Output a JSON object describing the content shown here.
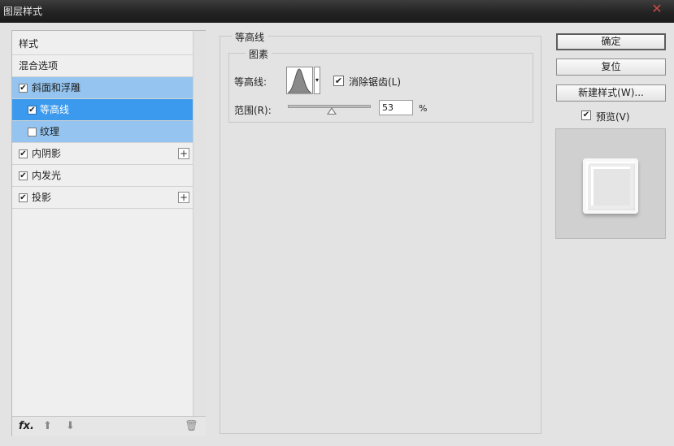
{
  "window": {
    "title": "图层样式",
    "close_glyph": "✕"
  },
  "styles_list": {
    "items": [
      {
        "label": "样式",
        "checkbox": false,
        "checked": false,
        "selected": "none",
        "plus": false,
        "indent": 0
      },
      {
        "label": "混合选项",
        "checkbox": false,
        "checked": false,
        "selected": "none",
        "plus": false,
        "indent": 0
      },
      {
        "label": "斜面和浮雕",
        "checkbox": true,
        "checked": true,
        "selected": "light",
        "plus": false,
        "indent": 0
      },
      {
        "label": "等高线",
        "checkbox": true,
        "checked": true,
        "selected": "strong",
        "plus": false,
        "indent": 1
      },
      {
        "label": "纹理",
        "checkbox": true,
        "checked": false,
        "selected": "light",
        "plus": false,
        "indent": 1
      },
      {
        "label": "内阴影",
        "checkbox": true,
        "checked": true,
        "selected": "none",
        "plus": true,
        "indent": 0
      },
      {
        "label": "内发光",
        "checkbox": true,
        "checked": true,
        "selected": "none",
        "plus": false,
        "indent": 0
      },
      {
        "label": "投影",
        "checkbox": true,
        "checked": true,
        "selected": "none",
        "plus": true,
        "indent": 0
      }
    ],
    "plus_glyph": "+",
    "check_glyph": "✔",
    "footer": {
      "fx": "fx.",
      "up": "⬆",
      "down": "⬇",
      "trash": "🗑"
    }
  },
  "contour_panel": {
    "group_title": "等高线",
    "subgroup_title": "图素",
    "contour_label": "等高线:",
    "anti_alias_label": "消除锯齿(L)",
    "anti_alias_checked": true,
    "range_label": "范围(R):",
    "range_value": "53",
    "range_unit": "%",
    "range_fraction": 0.53
  },
  "buttons": {
    "ok": "确定",
    "reset": "复位",
    "new_style": "新建样式(W)..."
  },
  "preview": {
    "label": "预览(V)",
    "checked": true
  },
  "colors": {
    "selected_strong": "#3c9aee",
    "selected_light": "#94c4ef",
    "dialog_bg": "#e3e3e3"
  }
}
